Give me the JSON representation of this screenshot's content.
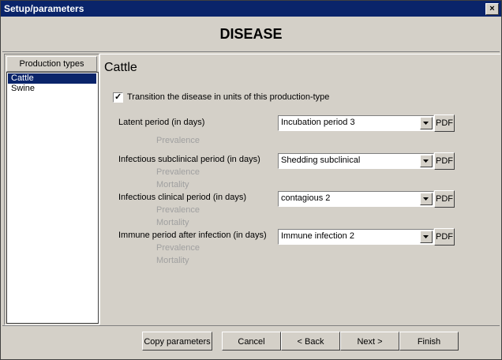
{
  "window": {
    "title": "Setup/parameters",
    "close_label": "×"
  },
  "header": {
    "title": "DISEASE"
  },
  "sidebar": {
    "header": "Production types",
    "items": [
      {
        "label": "Cattle",
        "selected": true
      },
      {
        "label": "Swine",
        "selected": false
      }
    ]
  },
  "content": {
    "title": "Cattle",
    "checkbox": {
      "label": "Transition the disease in units of this production-type",
      "checked": true
    },
    "rows": [
      {
        "label": "Latent period (in days)",
        "value": "Incubation period 3",
        "pdf": "PDF",
        "subs": [
          "Prevalence"
        ]
      },
      {
        "label": "Infectious subclinical period (in days)",
        "value": "Shedding subclinical",
        "pdf": "PDF",
        "subs": [
          "Prevalence",
          "Mortality"
        ]
      },
      {
        "label": "Infectious clinical period (in days)",
        "value": "contagious 2",
        "pdf": "PDF",
        "subs": [
          "Prevalence",
          "Mortality"
        ]
      },
      {
        "label": "Immune period after infection (in days)",
        "value": "Immune infection 2",
        "pdf": "PDF",
        "subs": [
          "Prevalence",
          "Mortality"
        ]
      }
    ]
  },
  "footer": {
    "copy": "Copy parameters",
    "cancel": "Cancel",
    "back": "< Back",
    "next": "Next >",
    "finish": "Finish"
  }
}
